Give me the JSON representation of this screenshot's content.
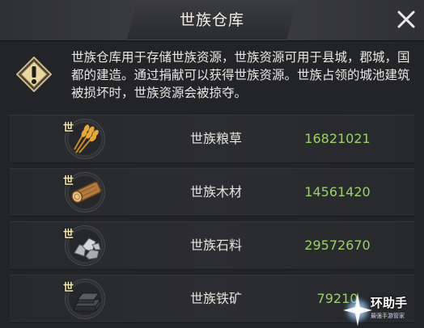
{
  "window": {
    "title": "世族仓库",
    "close_icon": "close-x-icon"
  },
  "info": {
    "icon": "warning-exclamation-icon",
    "text": "世族仓库用于存储世族资源，世族资源可用于县城，郡城，国都的建造。通过捐献可以获得世族资源。世族占领的城池建筑被损坏时，世族资源会被掠夺。"
  },
  "resources": [
    {
      "badge": "世",
      "name": "世族粮草",
      "value": "16821021",
      "icon": "wheat-icon"
    },
    {
      "badge": "世",
      "name": "世族木材",
      "value": "14561420",
      "icon": "wood-log-icon"
    },
    {
      "badge": "世",
      "name": "世族石料",
      "value": "29572670",
      "icon": "stone-icon"
    },
    {
      "badge": "世",
      "name": "世族铁矿",
      "value": "79210",
      "icon": "iron-ingot-icon"
    }
  ],
  "watermark": {
    "title": "环助手",
    "subtitle": "最强手游管家"
  },
  "colors": {
    "value_green": "#9bd16a",
    "title_text": "#f3efe6",
    "background": "#232427"
  }
}
